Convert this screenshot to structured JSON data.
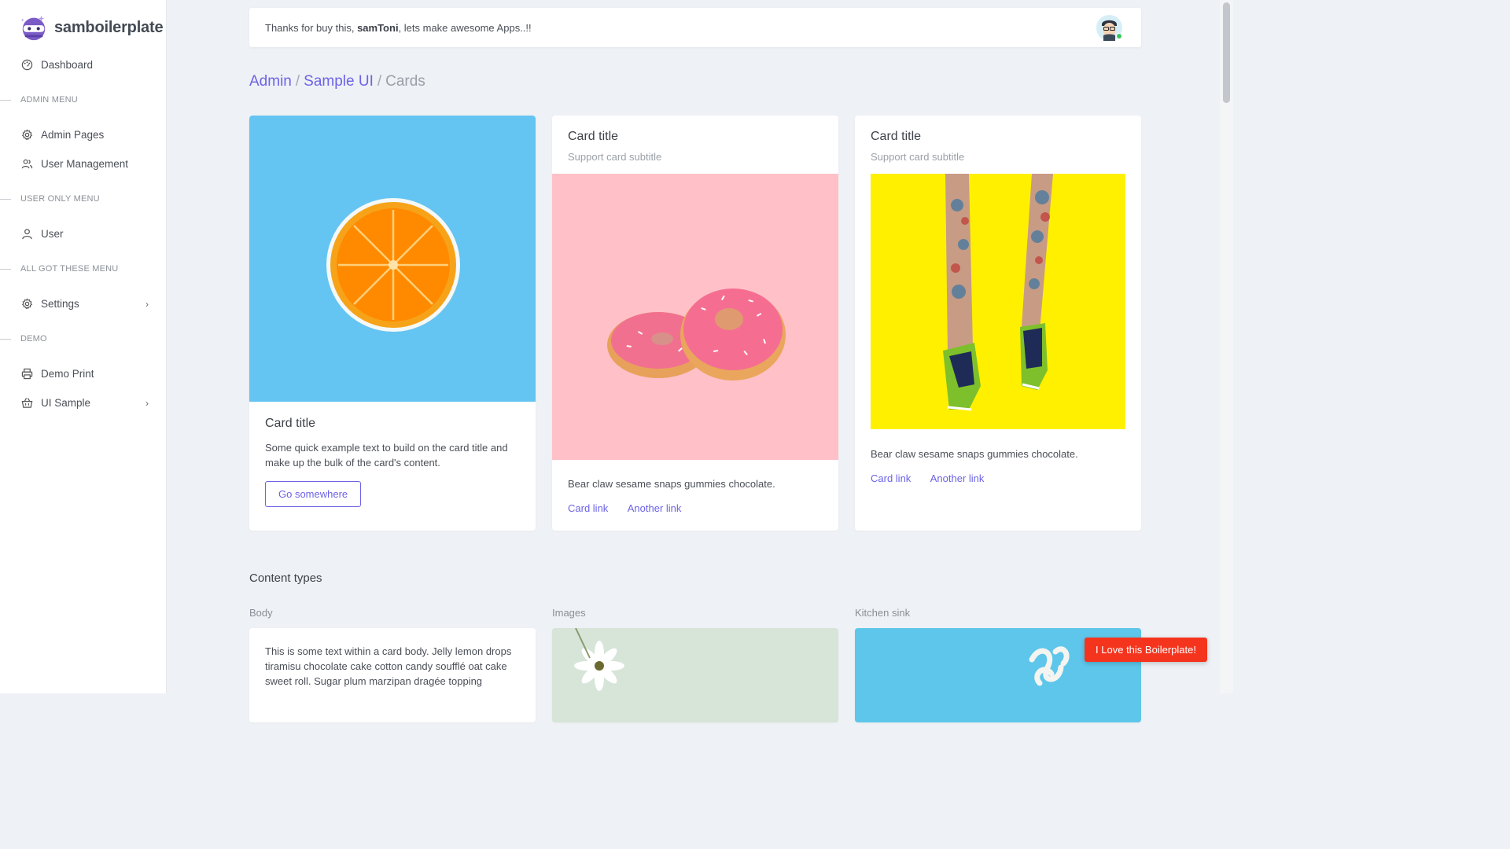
{
  "brand": {
    "name": "samboilerplate",
    "logo_icon": "ninja-logo-icon"
  },
  "sidebar": {
    "dashboard": "Dashboard",
    "sections": {
      "admin": "ADMIN MENU",
      "user_only": "USER ONLY MENU",
      "all": "ALL GOT THESE MENU",
      "demo": "DEMO"
    },
    "items": {
      "admin_pages": "Admin Pages",
      "user_management": "User Management",
      "user": "User",
      "settings": "Settings",
      "demo_print": "Demo Print",
      "ui_sample": "UI Sample"
    }
  },
  "topbar": {
    "message_prefix": "Thanks for buy this, ",
    "user_name": "samToni",
    "message_suffix": ", lets make awesome Apps..!!",
    "status_color": "#39c45c"
  },
  "breadcrumb": {
    "root": "Admin",
    "parent": "Sample UI",
    "current": "Cards"
  },
  "cards": [
    {
      "title": "Card title",
      "text": "Some quick example text to build on the card title and make up the bulk of the card's content.",
      "button": "Go somewhere",
      "image_bg": "#64c4f2"
    },
    {
      "title": "Card title",
      "subtitle": "Support card subtitle",
      "text": "Bear claw sesame snaps gummies chocolate.",
      "link1": "Card link",
      "link2": "Another link",
      "image_bg": "#ffc0c8"
    },
    {
      "title": "Card title",
      "subtitle": "Support card subtitle",
      "text": "Bear claw sesame snaps gummies chocolate.",
      "link1": "Card link",
      "link2": "Another link",
      "image_bg": "#fff000"
    }
  ],
  "content_types": {
    "title": "Content types",
    "body_label": "Body",
    "images_label": "Images",
    "kitchen_label": "Kitchen sink",
    "body_text": "This is some text within a card body. Jelly lemon drops tiramisu chocolate cake cotton candy soufflé oat cake sweet roll. Sugar plum marzipan dragée topping"
  },
  "love_button": "I Love this Boilerplate!",
  "colors": {
    "accent": "#6c63e6",
    "love": "#f5341e"
  }
}
